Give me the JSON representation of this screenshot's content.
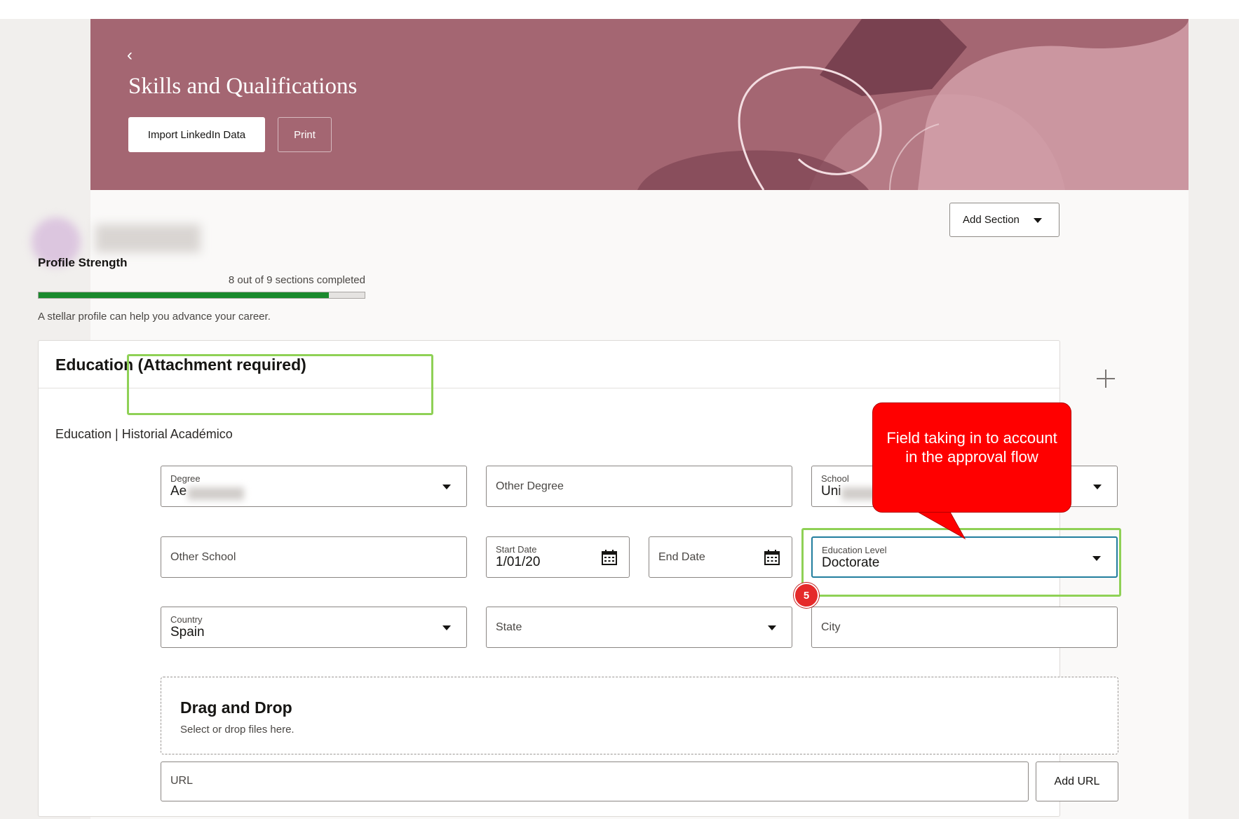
{
  "header": {
    "back_glyph": "‹",
    "title": "Skills and Qualifications",
    "import_label": "Import LinkedIn Data",
    "print_label": "Print"
  },
  "toolbar": {
    "add_section_label": "Add Section"
  },
  "profile_strength": {
    "title": "Profile Strength",
    "count_text": "8 out of 9 sections completed",
    "progress_fraction": 0.89,
    "hint": "A stellar profile can help you advance your career."
  },
  "education": {
    "title": "Education (Attachment required)",
    "subtitle": "Education | Historial Académico",
    "fields": {
      "degree": {
        "label": "Degree",
        "value": "Ae"
      },
      "other_degree": {
        "placeholder": "Other Degree"
      },
      "school": {
        "label": "School",
        "value": "Uni"
      },
      "other_school": {
        "placeholder": "Other School"
      },
      "start_date": {
        "label": "Start Date",
        "value": "1/01/20"
      },
      "end_date": {
        "placeholder": "End Date"
      },
      "education_level": {
        "label": "Education Level",
        "value": "Doctorate"
      },
      "country": {
        "label": "Country",
        "value": "Spain"
      },
      "state": {
        "placeholder": "State"
      },
      "city": {
        "placeholder": "City"
      }
    },
    "dropzone": {
      "title": "Drag and Drop",
      "subtitle": "Select or drop files here."
    },
    "url": {
      "placeholder": "URL",
      "add_label": "Add URL"
    }
  },
  "annotation": {
    "callout_text": "Field taking in to account in the approval flow",
    "badge_number": "5",
    "callout_color": "#ff0000",
    "highlight_color": "#8fd156"
  },
  "colors": {
    "hero": "#a46672",
    "progress": "#1b8a2e",
    "focus": "#227e9e"
  }
}
